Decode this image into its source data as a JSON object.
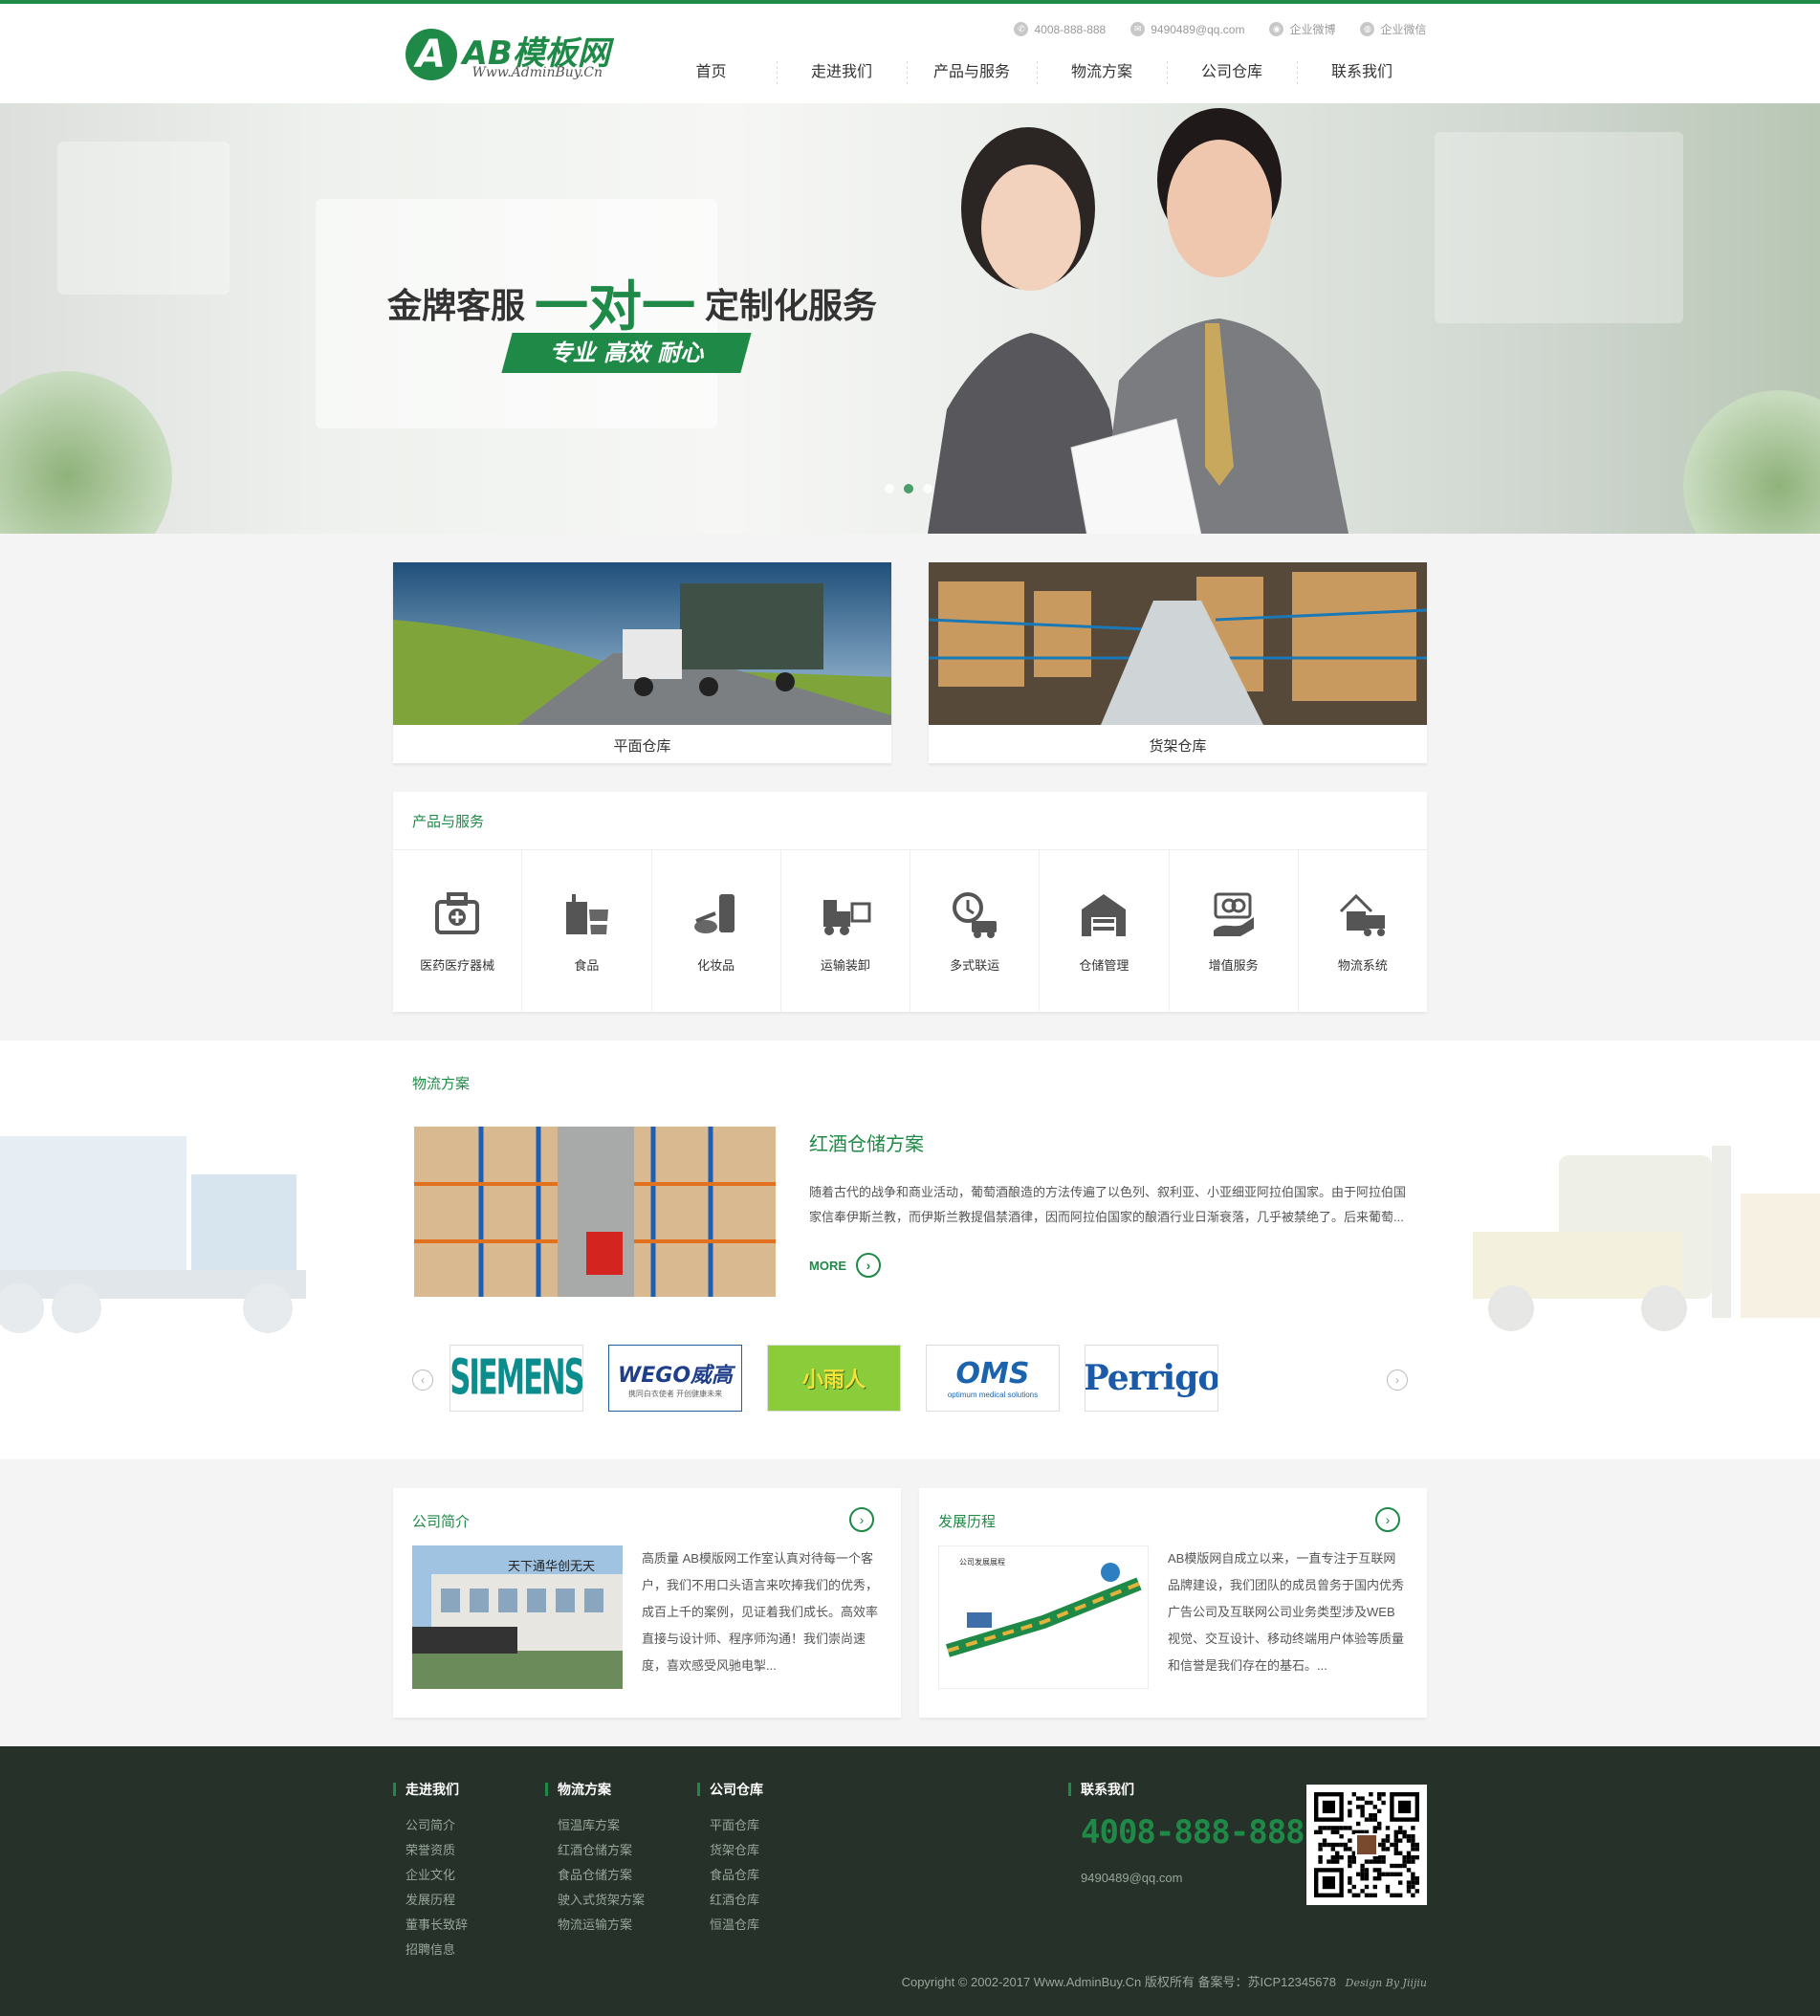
{
  "header": {
    "logo_mark": "A",
    "logo_title": "AB模板网",
    "logo_sub": "Www.AdminBuy.Cn",
    "toplinks": [
      {
        "icon": "phone-icon",
        "glyph": "✆",
        "label": "4008-888-888"
      },
      {
        "icon": "mail-icon",
        "glyph": "✉",
        "label": "9490489@qq.com"
      },
      {
        "icon": "weibo-icon",
        "glyph": "◉",
        "label": "企业微博"
      },
      {
        "icon": "wechat-icon",
        "glyph": "◍",
        "label": "企业微信"
      }
    ],
    "nav": [
      "首页",
      "走进我们",
      "产品与服务",
      "物流方案",
      "公司仓库",
      "联系我们"
    ]
  },
  "banner": {
    "title_left": "金牌客服",
    "title_mid": "一对一",
    "title_right": "定制化服务",
    "tagline": "专业 高效  耐心",
    "slides": 3,
    "active_slide": 2
  },
  "warehouses": [
    {
      "label": "平面仓库"
    },
    {
      "label": "货架仓库"
    }
  ],
  "services": {
    "title": "产品与服务",
    "items": [
      {
        "name": "医药医疗器械",
        "icon": "medical-kit-icon"
      },
      {
        "name": "食品",
        "icon": "food-icon"
      },
      {
        "name": "化妆品",
        "icon": "cosmetics-icon"
      },
      {
        "name": "运输装卸",
        "icon": "forklift-icon"
      },
      {
        "name": "多式联运",
        "icon": "multimodal-icon"
      },
      {
        "name": "仓储管理",
        "icon": "warehouse-icon"
      },
      {
        "name": "增值服务",
        "icon": "value-added-icon"
      },
      {
        "name": "物流系统",
        "icon": "logistics-system-icon"
      }
    ]
  },
  "logistics": {
    "title": "物流方案",
    "case_title": "红酒仓储方案",
    "case_desc": "随着古代的战争和商业活动，葡萄酒酿造的方法传遍了以色列、叙利亚、小亚细亚阿拉伯国家。由于阿拉伯国家信奉伊斯兰教，而伊斯兰教提倡禁酒律，因而阿拉伯国家的酿酒行业日渐衰落，几乎被禁绝了。后来葡萄...",
    "more": "MORE",
    "partners": [
      "SIEMENS",
      "WEGO威高",
      "小雨人",
      "OMS",
      "Perrigo"
    ],
    "partner_subs": {
      "wego": "携同白衣使者  开创健康未来",
      "oms": "optimum medical solutions"
    }
  },
  "about": {
    "title": "公司简介",
    "text": "高质量 AB模版网工作室认真对待每一个客户，我们不用口头语言来吹捧我们的优秀，成百上千的案例，见证着我们成长。高效率 直接与设计师、程序师沟通！我们崇尚速度，喜欢感受风驰电掣...",
    "sign": "天下通华创无天"
  },
  "history": {
    "title": "发展历程",
    "text": "AB模版网自成立以来，一直专注于互联网品牌建设，我们团队的成员曾务于国内优秀广告公司及互联网公司业务类型涉及WEB视觉、交互设计、移动终端用户体验等质量和信誉是我们存在的基石。...",
    "chart_title": "公司发展展程"
  },
  "footer": {
    "cols": [
      {
        "title": "走进我们",
        "links": [
          "公司简介",
          "荣誉资质",
          "企业文化",
          "发展历程",
          "董事长致辞",
          "招聘信息"
        ]
      },
      {
        "title": "物流方案",
        "links": [
          "恒温库方案",
          "红酒仓储方案",
          "食品仓储方案",
          "驶入式货架方案",
          "物流运输方案"
        ]
      },
      {
        "title": "公司仓库",
        "links": [
          "平面仓库",
          "货架仓库",
          "食品仓库",
          "红酒仓库",
          "恒温仓库"
        ]
      }
    ],
    "contact_title": "联系我们",
    "phone": "4008-888-888",
    "email": "9490489@qq.com",
    "copyright": "Copyright © 2002-2017 Www.AdminBuy.Cn 版权所有 备案号：苏ICP12345678",
    "design_by": "Design By Jiijiu"
  }
}
